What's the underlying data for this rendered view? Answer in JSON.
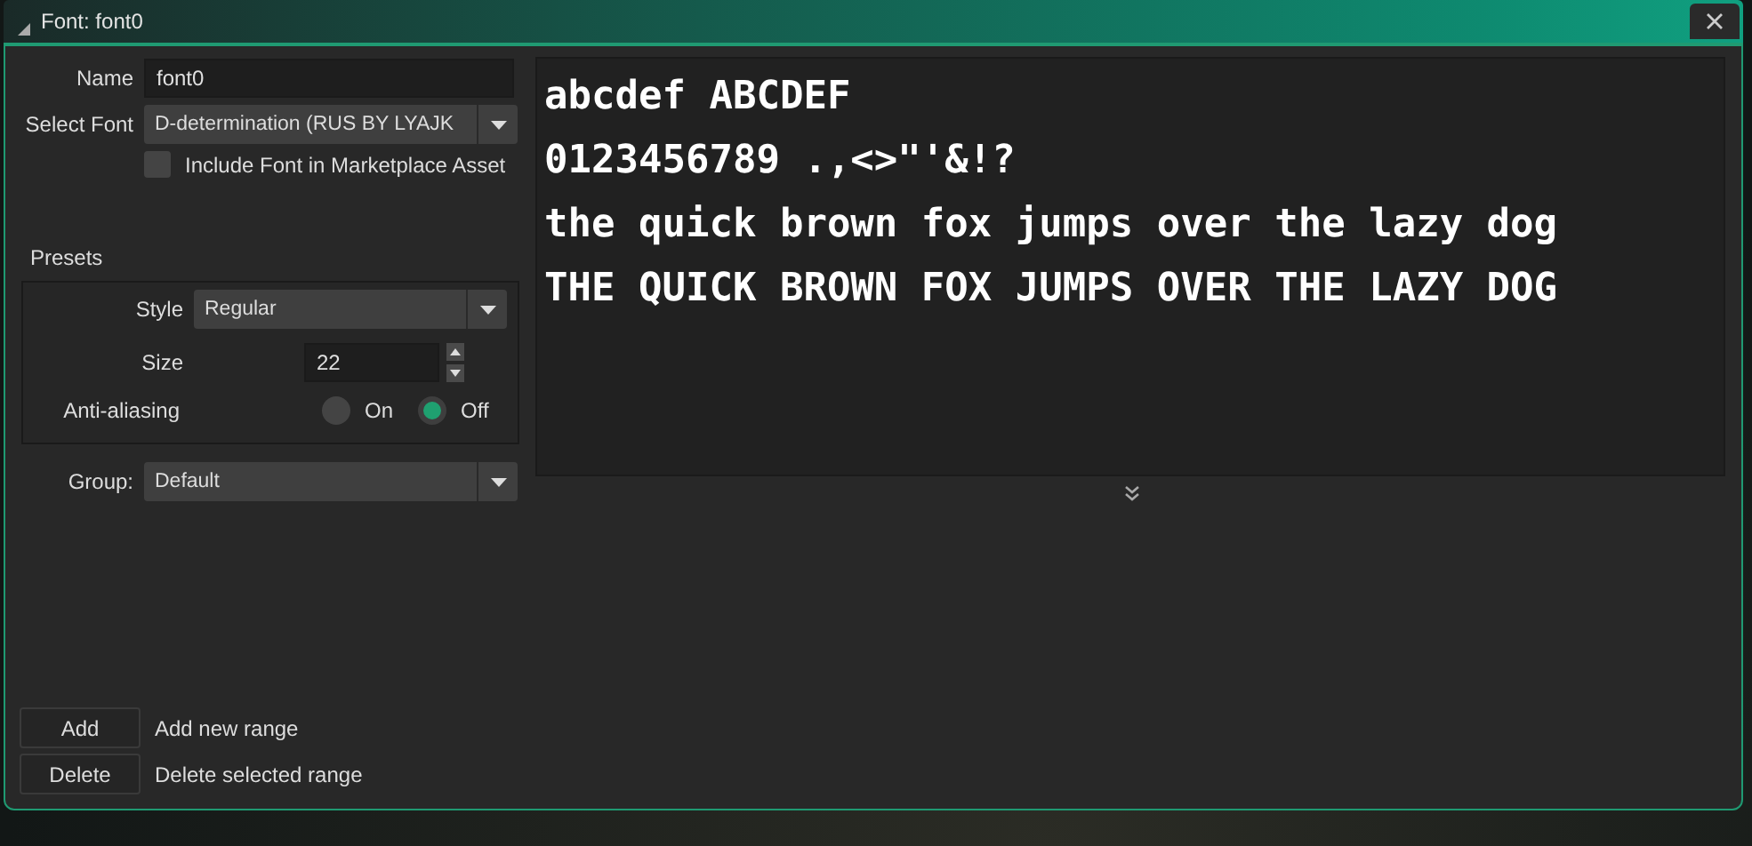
{
  "window": {
    "title": "Font: font0"
  },
  "name": {
    "label": "Name",
    "value": "font0"
  },
  "select_font": {
    "label": "Select Font",
    "value": "D-determination (RUS BY LYAJK"
  },
  "include_in_marketplace": {
    "label": "Include Font in Marketplace Asset",
    "checked": false
  },
  "presets": {
    "title": "Presets",
    "style": {
      "label": "Style",
      "value": "Regular"
    },
    "size": {
      "label": "Size",
      "value": "22"
    },
    "anti_aliasing": {
      "label": "Anti-aliasing",
      "options": [
        {
          "label": "On",
          "selected": false
        },
        {
          "label": "Off",
          "selected": true
        }
      ]
    }
  },
  "group": {
    "label": "Group:",
    "value": "Default"
  },
  "preview": {
    "lines": [
      "abcdef ABCDEF",
      "0123456789 .,<>\"'&!?",
      "the quick brown fox jumps over the lazy dog",
      "THE QUICK BROWN FOX JUMPS OVER THE LAZY DOG"
    ]
  },
  "ranges": [
    {
      "button": "Add",
      "description": "Add new range"
    },
    {
      "button": "Delete",
      "description": "Delete selected range"
    }
  ]
}
